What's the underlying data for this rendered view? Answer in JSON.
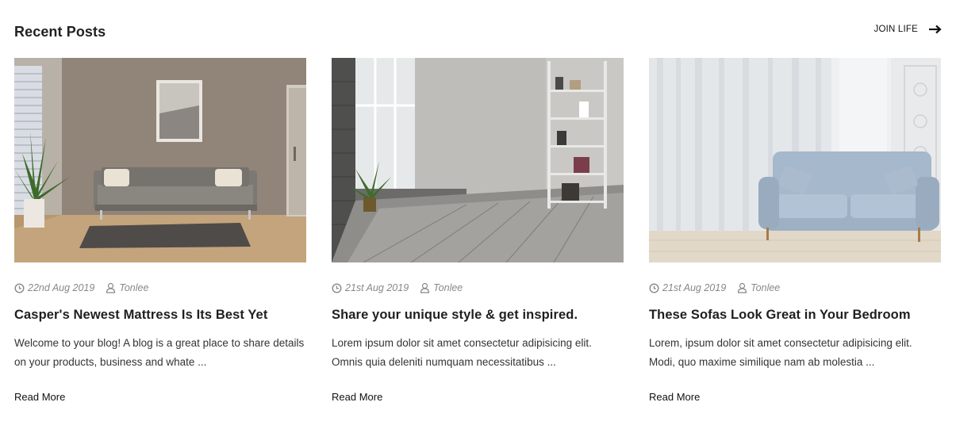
{
  "section": {
    "title": "Recent Posts",
    "join_label": "JOIN LIFE",
    "join_icon": "arrow-right-icon"
  },
  "posts": [
    {
      "date": "22nd Aug 2019",
      "author": "Tonlee",
      "title": "Casper's Newest Mattress Is Its Best Yet",
      "excerpt": "Welcome to your blog! A blog is a great place to share details on your products, business and whate ...",
      "read_more": "Read More"
    },
    {
      "date": "21st Aug 2019",
      "author": "Tonlee",
      "title": "Share your unique style & get inspired.",
      "excerpt": "Lorem ipsum dolor sit amet consectetur adipisicing elit. Omnis quia deleniti numquam necessitatibus ...",
      "read_more": "Read More"
    },
    {
      "date": "21st Aug 2019",
      "author": "Tonlee",
      "title": "These Sofas Look Great in Your Bedroom",
      "excerpt": "Lorem, ipsum dolor sit amet consectetur adipisicing elit. Modi, quo maxime similique nam ab molestia ...",
      "read_more": "Read More"
    }
  ],
  "icons": {
    "date": "clock-icon",
    "author": "user-icon"
  },
  "colors": {
    "text": "#222222",
    "meta": "#888888",
    "background": "#ffffff"
  }
}
